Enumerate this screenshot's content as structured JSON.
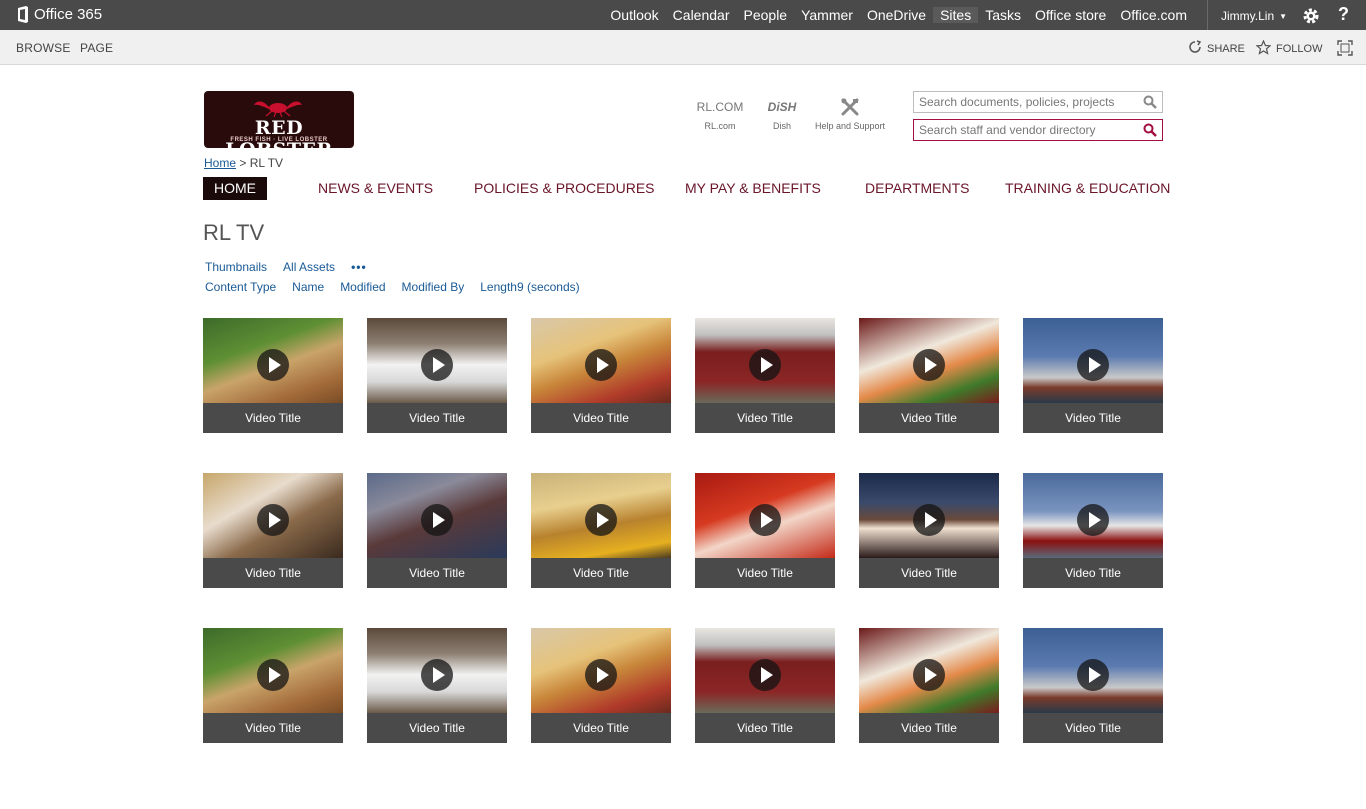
{
  "suitebar": {
    "brand": "Office 365",
    "links": [
      "Outlook",
      "Calendar",
      "People",
      "Yammer",
      "OneDrive",
      "Sites",
      "Tasks",
      "Office store",
      "Office.com"
    ],
    "active_link": "Sites",
    "user": "Jimmy.Lin",
    "settings_icon": "gear-icon",
    "help_label": "?"
  },
  "ribbon": {
    "browse": "BROWSE",
    "page": "PAGE",
    "share": "SHARE",
    "follow": "FOLLOW"
  },
  "header": {
    "logo_brand": "RED LOBSTER",
    "logo_tagline": "FRESH FISH · LIVE LOBSTER",
    "quick_links": [
      {
        "main": "RL.COM",
        "sub": "RL.com"
      },
      {
        "main": "DiSH",
        "sub": "Dish"
      },
      {
        "main": "",
        "sub": "Help and Support"
      }
    ],
    "search_docs_placeholder": "Search documents, policies, projects",
    "search_staff_placeholder": "Search staff and vendor directory"
  },
  "breadcrumb": {
    "home": "Home",
    "sep": ">",
    "current": "RL TV"
  },
  "nav": [
    "HOME",
    "NEWS & EVENTS",
    "POLICIES & PROCEDURES",
    "MY PAY & BENEFITS",
    "DEPARTMENTS",
    "TRAINING & EDUCATION"
  ],
  "page": {
    "title": "RL TV",
    "views": [
      "Thumbnails",
      "All Assets",
      "•••"
    ],
    "columns": [
      "Content Type",
      "Name",
      "Modified",
      "Modified By",
      "Length9 (seconds)"
    ]
  },
  "videos": {
    "title_label": "Video Title",
    "rows": [
      [
        "fish-broccoli",
        "chef",
        "lobster-tail",
        "restaurant-exterior",
        "shrimp-platter",
        "lighthouse"
      ],
      [
        "family-bell",
        "lobster-trap",
        "grilled-fish",
        "lobster-claw",
        "restaurant-sign",
        "lighthouse-sign"
      ],
      [
        "fish-broccoli",
        "chef",
        "lobster-tail",
        "restaurant-exterior",
        "shrimp-platter",
        "lighthouse"
      ]
    ]
  },
  "colors": {
    "suitebar": "#4a4a4a",
    "nav_text": "#6a1528",
    "link": "#1a5a96",
    "search_accent": "#a31040"
  }
}
